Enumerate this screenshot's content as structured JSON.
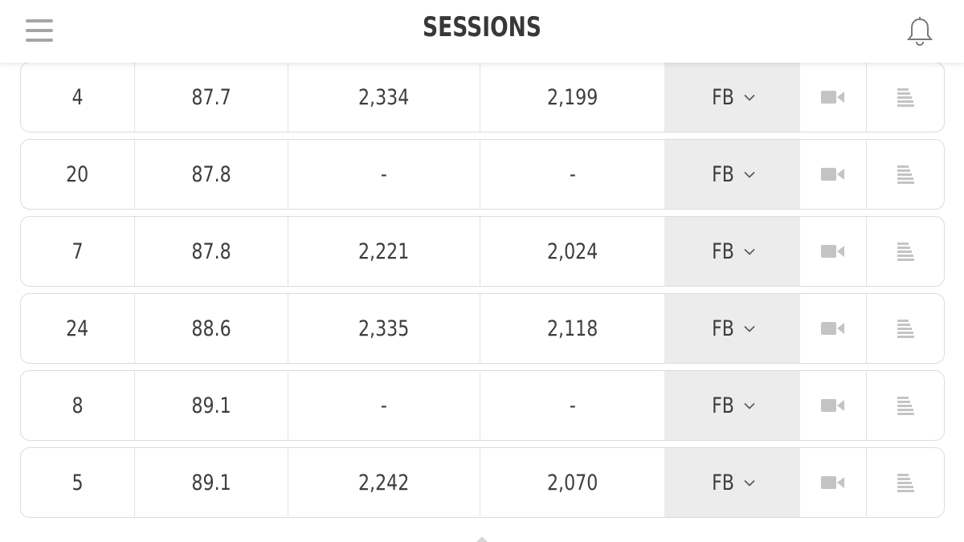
{
  "header": {
    "title": "SESSIONS",
    "menu_icon": "hamburger-menu-icon",
    "notification_icon": "bell-icon"
  },
  "rows": [
    {
      "id": "4",
      "value": "87.7",
      "col3": "2,334",
      "col4": "2,199",
      "tag": "FB"
    },
    {
      "id": "20",
      "value": "87.8",
      "col3": "-",
      "col4": "-",
      "tag": "FB"
    },
    {
      "id": "7",
      "value": "87.8",
      "col3": "2,221",
      "col4": "2,024",
      "tag": "FB"
    },
    {
      "id": "24",
      "value": "88.6",
      "col3": "2,335",
      "col4": "2,118",
      "tag": "FB"
    },
    {
      "id": "8",
      "value": "89.1",
      "col3": "-",
      "col4": "-",
      "tag": "FB"
    },
    {
      "id": "5",
      "value": "89.1",
      "col3": "2,242",
      "col4": "2,070",
      "tag": "FB"
    }
  ],
  "row_icons": {
    "video": "video-camera-icon",
    "notes": "notes-icon",
    "dropdown": "chevron-down-icon"
  },
  "colors": {
    "text": "#3d3d3d",
    "tag_bg": "#ececec",
    "icon": "#c4c4c4",
    "border": "#dcdcdc"
  }
}
